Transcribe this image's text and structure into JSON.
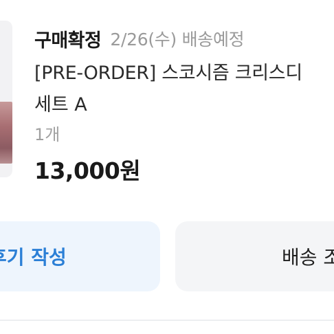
{
  "order": {
    "status": "구매확정",
    "delivery_text": "2/26(수) 배송예정",
    "product_title_line1": "[PRE-ORDER] 스코시즘 크리스디",
    "product_title_line2": "세트 A",
    "quantity": "1개",
    "price": "13,000원"
  },
  "actions": {
    "review_label": "후기 작성",
    "shipping_label": "배송 조회"
  },
  "colors": {
    "accent": "#2b7fd6",
    "review_button_bg": "#eef5fd",
    "shipping_button_bg": "#f4f5f7"
  }
}
